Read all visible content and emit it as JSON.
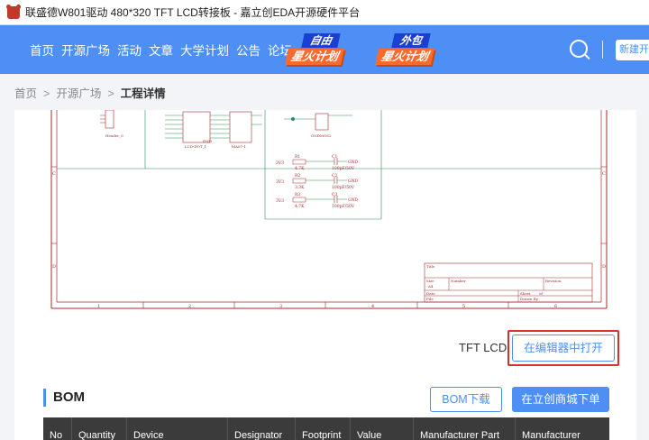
{
  "window": {
    "title": "联盛德W801驱动 480*320 TFT LCD转接板 - 嘉立创EDA开源硬件平台"
  },
  "navbar": {
    "links": [
      "首页",
      "开源广场",
      "活动",
      "文章",
      "大学计划",
      "公告",
      "论坛"
    ],
    "promo1_top": "自由",
    "promo1_bottom": "星火计划",
    "promo2_top": "外包",
    "promo2_bottom": "星火计划",
    "new_project_label": "新建开"
  },
  "breadcrumb": {
    "items": [
      "首页",
      "开源广场"
    ],
    "separator": ">",
    "current": "工程详情"
  },
  "schematic": {
    "component_labels": [
      "R1",
      "R2",
      "R3",
      "C1",
      "C2",
      "C3",
      "4.7K",
      "3.3K",
      "4.7K",
      "100pF/50V",
      "GND",
      "3V3",
      "GNDMOS2",
      "Header_9",
      "LCD-DOT_1",
      "MA07-1"
    ],
    "title_block": {
      "title_label": "Title",
      "size_label": "Size",
      "number_label": "Number",
      "revision_label": "Revision",
      "size_value": "A4",
      "date_label": "Date",
      "file_label": "File",
      "sheet_label": "Sheet",
      "sheet_value": "of",
      "drawn_label": "Drawn By"
    },
    "border_numbers": [
      "1",
      "2",
      "3",
      "4",
      "5",
      "6"
    ],
    "border_letters": [
      "C",
      "D"
    ]
  },
  "toolbar": {
    "label": "TFT  LCD",
    "open_editor_label": "在编辑器中打开"
  },
  "bom": {
    "title": "BOM",
    "download_label": "BOM下载",
    "order_label": "在立创商城下单",
    "columns": [
      "No",
      "Quantity",
      "Device",
      "Designator",
      "Footprint",
      "Value",
      "Manufacturer Part",
      "Manufacturer"
    ]
  },
  "colors": {
    "brand_blue": "#4d8ff5",
    "highlight_red": "#d9302b",
    "schematic_red": "#a52a2a",
    "table_header": "#3b3b3b"
  }
}
